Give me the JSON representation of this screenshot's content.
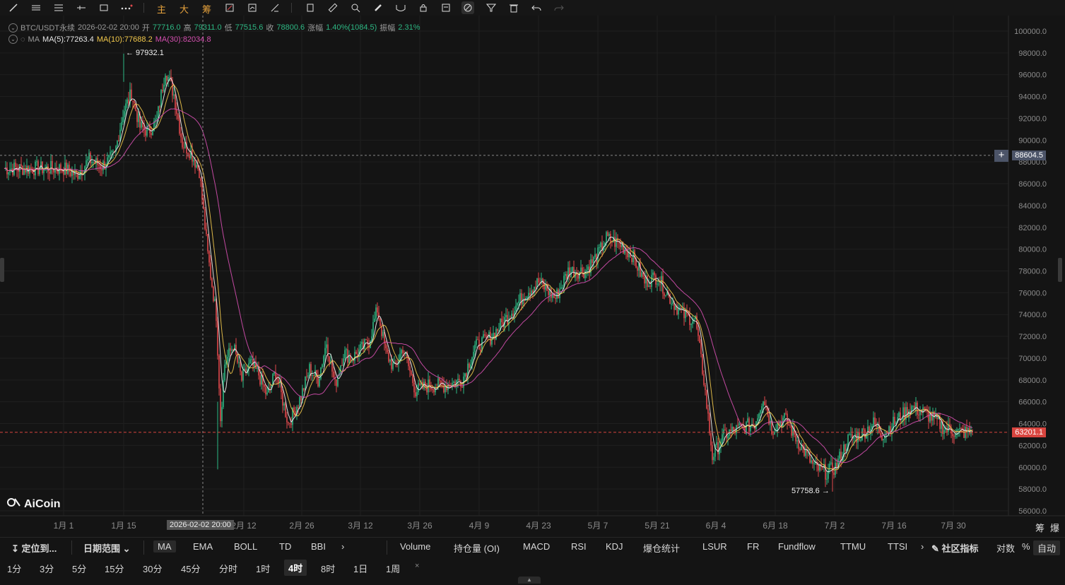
{
  "toolbar": {
    "label_main": "主",
    "label_big": "大",
    "label_chips": "筹"
  },
  "legend": {
    "symbol": "BTC/USDT永续",
    "datetime": "2026-02-02 20:00",
    "open_label": "开",
    "open": "77716.0",
    "high_label": "高",
    "high": "79311.0",
    "low_label": "低",
    "low": "77515.6",
    "close_label": "收",
    "close": "78800.6",
    "change_label": "涨幅",
    "change": "1.40%(1084.5)",
    "amp_label": "振幅",
    "amp": "2.31%",
    "ma_label": "MA",
    "ma5": "MA(5):77263.4",
    "ma10": "MA(10):77688.2",
    "ma30": "MA(30):82034.8"
  },
  "price_axis": [
    "100000.0",
    "98000.0",
    "96000.0",
    "94000.0",
    "92000.0",
    "90000.0",
    "88000.0",
    "86000.0",
    "84000.0",
    "82000.0",
    "80000.0",
    "78000.0",
    "76000.0",
    "74000.0",
    "72000.0",
    "70000.0",
    "68000.0",
    "66000.0",
    "64000.0",
    "62000.0",
    "60000.0",
    "58000.0",
    "56000.0"
  ],
  "date_axis": [
    "1月 1",
    "1月 15",
    "2月 12",
    "2月 26",
    "3月 12",
    "3月 26",
    "4月 9",
    "4月 23",
    "5月 7",
    "5月 21",
    "6月 4",
    "6月 18",
    "7月 2",
    "7月 16",
    "7月 30"
  ],
  "crosshair": {
    "price": "88604.5",
    "time": "2026-02-02 20:00"
  },
  "current_price": "63201.1",
  "high_marker": "← 97932.1",
  "low_marker": "57758.6 →",
  "logo": "AiCoin",
  "chart_right": {
    "btn1": "筹",
    "btn2": "爆"
  },
  "indicators_bar": {
    "locate": "定位到...",
    "date_range": "日期范围",
    "main": [
      "MA",
      "EMA",
      "BOLL",
      "TD",
      "BBI"
    ],
    "sub": [
      "Volume",
      "持仓量 (OI)",
      "MACD",
      "RSI",
      "KDJ",
      "爆仓统计",
      "LSUR",
      "FR",
      "Fundflow",
      "TTMU",
      "TTSI"
    ],
    "community": "社区指标",
    "log": "对数",
    "percent": "%",
    "auto": "自动"
  },
  "timeframes": [
    "1分",
    "3分",
    "5分",
    "15分",
    "30分",
    "45分",
    "分时",
    "1时",
    "4时",
    "8时",
    "1日",
    "1周"
  ],
  "selected_timeframe": "4时",
  "colors": {
    "up": "#2db783",
    "down": "#e0484c",
    "ma5": "#f5f5f5",
    "ma10": "#f2c94c",
    "ma30": "#d54fb0",
    "accent": "#e6a23c"
  },
  "chart_data": {
    "type": "candlestick",
    "x_range": [
      "2026-01-01",
      "2026-08-02"
    ],
    "ylim": [
      56000,
      100000
    ],
    "anchors_close": [
      [
        "2026-01-01",
        87400
      ],
      [
        "2026-01-04",
        86800
      ],
      [
        "2026-01-07",
        88200
      ],
      [
        "2026-01-10",
        87600
      ],
      [
        "2026-01-13",
        88600
      ],
      [
        "2026-01-15",
        92500
      ],
      [
        "2026-01-17",
        94300
      ],
      [
        "2026-01-19",
        91200
      ],
      [
        "2026-01-21",
        90800
      ],
      [
        "2026-01-23",
        91800
      ],
      [
        "2026-01-25",
        96500
      ],
      [
        "2026-01-27",
        94200
      ],
      [
        "2026-01-29",
        89700
      ],
      [
        "2026-01-31",
        88900
      ],
      [
        "2026-02-02",
        87200
      ],
      [
        "2026-02-04",
        79500
      ],
      [
        "2026-02-06",
        74000
      ],
      [
        "2026-02-07",
        64500
      ],
      [
        "2026-02-08",
        69500
      ],
      [
        "2026-02-10",
        71200
      ],
      [
        "2026-02-12",
        68000
      ],
      [
        "2026-02-14",
        69500
      ],
      [
        "2026-02-16",
        68500
      ],
      [
        "2026-02-18",
        66500
      ],
      [
        "2026-02-20",
        68800
      ],
      [
        "2026-02-23",
        64000
      ],
      [
        "2026-02-26",
        66500
      ],
      [
        "2026-02-28",
        69000
      ],
      [
        "2026-03-02",
        68000
      ],
      [
        "2026-03-04",
        71500
      ],
      [
        "2026-03-06",
        67500
      ],
      [
        "2026-03-08",
        70500
      ],
      [
        "2026-03-10",
        70000
      ],
      [
        "2026-03-14",
        71500
      ],
      [
        "2026-03-16",
        74500
      ],
      [
        "2026-03-18",
        70500
      ],
      [
        "2026-03-20",
        69000
      ],
      [
        "2026-03-22",
        71000
      ],
      [
        "2026-03-25",
        67000
      ],
      [
        "2026-03-28",
        67500
      ],
      [
        "2026-04-01",
        67500
      ],
      [
        "2026-04-05",
        68000
      ],
      [
        "2026-04-08",
        71000
      ],
      [
        "2026-04-12",
        72000
      ],
      [
        "2026-04-16",
        74000
      ],
      [
        "2026-04-20",
        76000
      ],
      [
        "2026-04-23",
        77000
      ],
      [
        "2026-04-27",
        75500
      ],
      [
        "2026-04-30",
        78000
      ],
      [
        "2026-05-04",
        78000
      ],
      [
        "2026-05-07",
        79500
      ],
      [
        "2026-05-09",
        81000
      ],
      [
        "2026-05-12",
        80500
      ],
      [
        "2026-05-15",
        79500
      ],
      [
        "2026-05-18",
        77000
      ],
      [
        "2026-05-21",
        77500
      ],
      [
        "2026-05-24",
        75500
      ],
      [
        "2026-05-27",
        74000
      ],
      [
        "2026-05-30",
        73500
      ],
      [
        "2026-06-01",
        68000
      ],
      [
        "2026-06-03",
        61000
      ],
      [
        "2026-06-06",
        63000
      ],
      [
        "2026-06-09",
        63500
      ],
      [
        "2026-06-13",
        64000
      ],
      [
        "2026-06-15",
        66500
      ],
      [
        "2026-06-17",
        63500
      ],
      [
        "2026-06-20",
        64500
      ],
      [
        "2026-06-23",
        62500
      ],
      [
        "2026-06-27",
        60000
      ],
      [
        "2026-06-30",
        59500
      ],
      [
        "2026-07-02",
        60000
      ],
      [
        "2026-07-05",
        62500
      ],
      [
        "2026-07-08",
        63000
      ],
      [
        "2026-07-11",
        64000
      ],
      [
        "2026-07-13",
        63000
      ],
      [
        "2026-07-17",
        64500
      ],
      [
        "2026-07-20",
        65500
      ],
      [
        "2026-07-23",
        65000
      ],
      [
        "2026-07-25",
        64500
      ],
      [
        "2026-07-28",
        63500
      ],
      [
        "2026-07-31",
        63201.1
      ]
    ],
    "high": 97932.1,
    "low": 57758.6,
    "last": 63201.1,
    "crosshair_price": 88604.5,
    "indicators": [
      "MA(5)",
      "MA(10)",
      "MA(30)"
    ]
  }
}
